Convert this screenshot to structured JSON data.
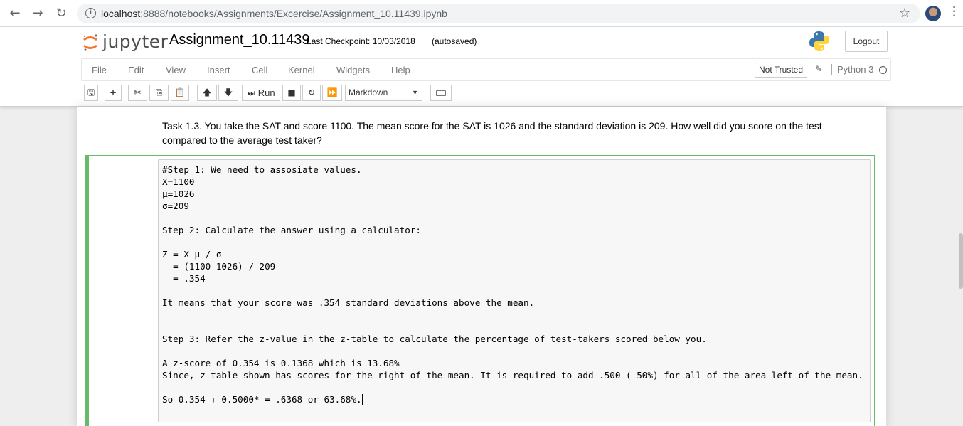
{
  "browser": {
    "url_host": "localhost",
    "url_path": ":8888/notebooks/Assignments/Excercise/Assignment_10.11439.ipynb"
  },
  "header": {
    "logo_text": "jupyter",
    "notebook_name": "Assignment_10.11439",
    "checkpoint": "Last Checkpoint: 10/03/2018",
    "autosave": "(autosaved)",
    "logout_label": "Logout"
  },
  "menubar": {
    "items": [
      "File",
      "Edit",
      "View",
      "Insert",
      "Cell",
      "Kernel",
      "Widgets",
      "Help"
    ],
    "trust_label": "Not Trusted",
    "kernel_name": "Python 3"
  },
  "toolbar": {
    "run_label": "Run",
    "cell_type": "Markdown"
  },
  "markdown_cell": {
    "text": "Task 1.3. You take the SAT and score 1100. The mean score for the SAT is 1026 and the standard deviation is 209. How well did you score on the test compared to the average test taker?"
  },
  "edit_cell": {
    "lines": [
      "#Step 1: We need to assosiate values.",
      "X=1100",
      "μ=1026",
      "σ=209",
      "",
      "Step 2: Calculate the answer using a calculator:",
      "",
      "Z = X-μ / σ",
      "  = (1100-1026) / 209",
      "  = .354",
      "",
      "It means that your score was .354 standard deviations above the mean.",
      "",
      "",
      "Step 3: Refer the z-value in the z-table to calculate the percentage of test-takers scored below you.",
      "",
      "A z-score of 0.354 is 0.1368 which is 13.68%",
      "Since, z-table shown has scores for the right of the mean. It is required to add .500 ( 50%) for all of the area left of the mean.",
      "",
      "So 0.354 + 0.5000* = .6368 or 63.68%."
    ]
  }
}
